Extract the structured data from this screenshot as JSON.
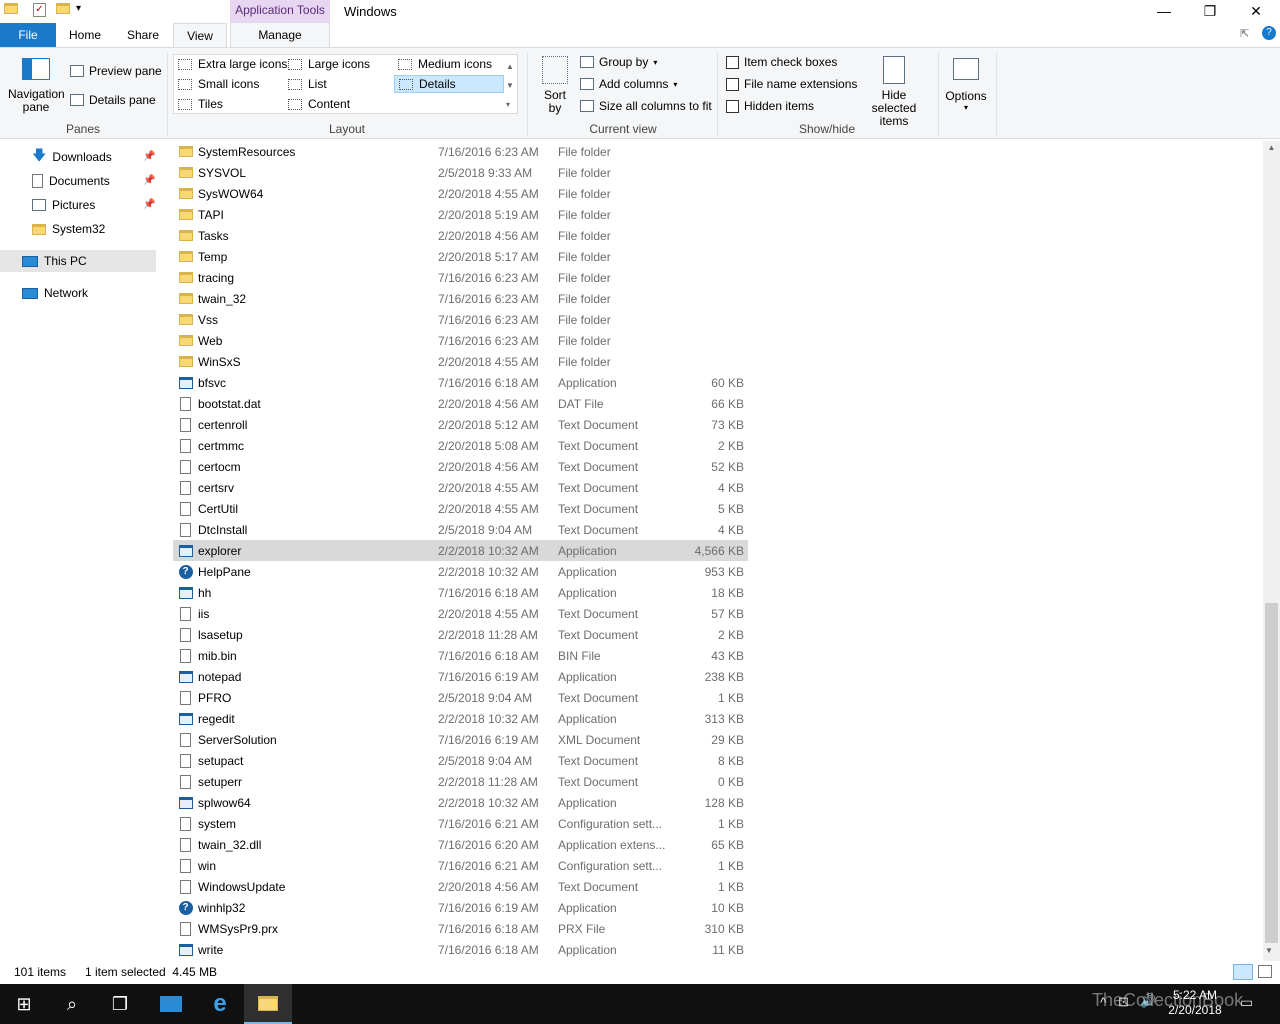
{
  "window": {
    "title": "Windows",
    "context_tab": "Application Tools",
    "minimize": "—",
    "maximize": "❐",
    "close": "✕"
  },
  "tabs": {
    "file": "File",
    "home": "Home",
    "share": "Share",
    "view": "View",
    "manage": "Manage"
  },
  "ribbon": {
    "panes": {
      "navigation_pane": "Navigation pane",
      "preview_pane": "Preview pane",
      "details_pane": "Details pane",
      "label": "Panes"
    },
    "layout": {
      "extra_large_icons": "Extra large icons",
      "large_icons": "Large icons",
      "medium_icons": "Medium icons",
      "small_icons": "Small icons",
      "list": "List",
      "details": "Details",
      "tiles": "Tiles",
      "content": "Content",
      "label": "Layout"
    },
    "current_view": {
      "sort_by": "Sort by",
      "group_by": "Group by",
      "add_columns": "Add columns",
      "size_all_columns": "Size all columns to fit",
      "label": "Current view"
    },
    "show_hide": {
      "item_check_boxes": "Item check boxes",
      "file_name_extensions": "File name extensions",
      "hidden_items": "Hidden items",
      "hide_selected_items": "Hide selected items",
      "label": "Show/hide"
    },
    "options": "Options"
  },
  "nav": {
    "items": [
      {
        "label": "Downloads",
        "pinned": true
      },
      {
        "label": "Documents",
        "pinned": true
      },
      {
        "label": "Pictures",
        "pinned": true
      },
      {
        "label": "System32",
        "pinned": false
      },
      {
        "label": "This PC",
        "pinned": false
      },
      {
        "label": "Network",
        "pinned": false
      }
    ]
  },
  "files": [
    {
      "name": "SystemResources",
      "date": "7/16/2016 6:23 AM",
      "type": "File folder",
      "size": "",
      "icon": "folder"
    },
    {
      "name": "SYSVOL",
      "date": "2/5/2018 9:33 AM",
      "type": "File folder",
      "size": "",
      "icon": "folder"
    },
    {
      "name": "SysWOW64",
      "date": "2/20/2018 4:55 AM",
      "type": "File folder",
      "size": "",
      "icon": "folder"
    },
    {
      "name": "TAPI",
      "date": "2/20/2018 5:19 AM",
      "type": "File folder",
      "size": "",
      "icon": "folder"
    },
    {
      "name": "Tasks",
      "date": "2/20/2018 4:56 AM",
      "type": "File folder",
      "size": "",
      "icon": "folder"
    },
    {
      "name": "Temp",
      "date": "2/20/2018 5:17 AM",
      "type": "File folder",
      "size": "",
      "icon": "folder"
    },
    {
      "name": "tracing",
      "date": "7/16/2016 6:23 AM",
      "type": "File folder",
      "size": "",
      "icon": "folder"
    },
    {
      "name": "twain_32",
      "date": "7/16/2016 6:23 AM",
      "type": "File folder",
      "size": "",
      "icon": "folder"
    },
    {
      "name": "Vss",
      "date": "7/16/2016 6:23 AM",
      "type": "File folder",
      "size": "",
      "icon": "folder"
    },
    {
      "name": "Web",
      "date": "7/16/2016 6:23 AM",
      "type": "File folder",
      "size": "",
      "icon": "folder"
    },
    {
      "name": "WinSxS",
      "date": "2/20/2018 4:55 AM",
      "type": "File folder",
      "size": "",
      "icon": "folder"
    },
    {
      "name": "bfsvc",
      "date": "7/16/2016 6:18 AM",
      "type": "Application",
      "size": "60 KB",
      "icon": "app"
    },
    {
      "name": "bootstat.dat",
      "date": "2/20/2018 4:56 AM",
      "type": "DAT File",
      "size": "66 KB",
      "icon": "doc"
    },
    {
      "name": "certenroll",
      "date": "2/20/2018 5:12 AM",
      "type": "Text Document",
      "size": "73 KB",
      "icon": "doc"
    },
    {
      "name": "certmmc",
      "date": "2/20/2018 5:08 AM",
      "type": "Text Document",
      "size": "2 KB",
      "icon": "doc"
    },
    {
      "name": "certocm",
      "date": "2/20/2018 4:56 AM",
      "type": "Text Document",
      "size": "52 KB",
      "icon": "doc"
    },
    {
      "name": "certsrv",
      "date": "2/20/2018 4:55 AM",
      "type": "Text Document",
      "size": "4 KB",
      "icon": "doc"
    },
    {
      "name": "CertUtil",
      "date": "2/20/2018 4:55 AM",
      "type": "Text Document",
      "size": "5 KB",
      "icon": "doc"
    },
    {
      "name": "DtcInstall",
      "date": "2/5/2018 9:04 AM",
      "type": "Text Document",
      "size": "4 KB",
      "icon": "doc"
    },
    {
      "name": "explorer",
      "date": "2/2/2018 10:32 AM",
      "type": "Application",
      "size": "4,566 KB",
      "icon": "app",
      "selected": true
    },
    {
      "name": "HelpPane",
      "date": "2/2/2018 10:32 AM",
      "type": "Application",
      "size": "953 KB",
      "icon": "help"
    },
    {
      "name": "hh",
      "date": "7/16/2016 6:18 AM",
      "type": "Application",
      "size": "18 KB",
      "icon": "app"
    },
    {
      "name": "iis",
      "date": "2/20/2018 4:55 AM",
      "type": "Text Document",
      "size": "57 KB",
      "icon": "doc"
    },
    {
      "name": "lsasetup",
      "date": "2/2/2018 11:28 AM",
      "type": "Text Document",
      "size": "2 KB",
      "icon": "doc"
    },
    {
      "name": "mib.bin",
      "date": "7/16/2016 6:18 AM",
      "type": "BIN File",
      "size": "43 KB",
      "icon": "doc"
    },
    {
      "name": "notepad",
      "date": "7/16/2016 6:19 AM",
      "type": "Application",
      "size": "238 KB",
      "icon": "app"
    },
    {
      "name": "PFRO",
      "date": "2/5/2018 9:04 AM",
      "type": "Text Document",
      "size": "1 KB",
      "icon": "doc"
    },
    {
      "name": "regedit",
      "date": "2/2/2018 10:32 AM",
      "type": "Application",
      "size": "313 KB",
      "icon": "app"
    },
    {
      "name": "ServerSolution",
      "date": "7/16/2016 6:19 AM",
      "type": "XML Document",
      "size": "29 KB",
      "icon": "doc"
    },
    {
      "name": "setupact",
      "date": "2/5/2018 9:04 AM",
      "type": "Text Document",
      "size": "8 KB",
      "icon": "doc"
    },
    {
      "name": "setuperr",
      "date": "2/2/2018 11:28 AM",
      "type": "Text Document",
      "size": "0 KB",
      "icon": "doc"
    },
    {
      "name": "splwow64",
      "date": "2/2/2018 10:32 AM",
      "type": "Application",
      "size": "128 KB",
      "icon": "app"
    },
    {
      "name": "system",
      "date": "7/16/2016 6:21 AM",
      "type": "Configuration sett...",
      "size": "1 KB",
      "icon": "doc"
    },
    {
      "name": "twain_32.dll",
      "date": "7/16/2016 6:20 AM",
      "type": "Application extens...",
      "size": "65 KB",
      "icon": "doc"
    },
    {
      "name": "win",
      "date": "7/16/2016 6:21 AM",
      "type": "Configuration sett...",
      "size": "1 KB",
      "icon": "doc"
    },
    {
      "name": "WindowsUpdate",
      "date": "2/20/2018 4:56 AM",
      "type": "Text Document",
      "size": "1 KB",
      "icon": "doc"
    },
    {
      "name": "winhlp32",
      "date": "7/16/2016 6:19 AM",
      "type": "Application",
      "size": "10 KB",
      "icon": "help"
    },
    {
      "name": "WMSysPr9.prx",
      "date": "7/16/2016 6:18 AM",
      "type": "PRX File",
      "size": "310 KB",
      "icon": "doc"
    },
    {
      "name": "write",
      "date": "7/16/2016 6:18 AM",
      "type": "Application",
      "size": "11 KB",
      "icon": "app"
    }
  ],
  "status": {
    "item_count": "101 items",
    "selection": "1 item selected  4.45 MB"
  },
  "taskbar": {
    "time": "5:22 AM",
    "date": "2/20/2018",
    "watermark": "TheCollectionBook"
  },
  "colors": {
    "accent": "#1979ca",
    "selection": "#d9d9d9",
    "context_tab": "#e7d6f2"
  }
}
